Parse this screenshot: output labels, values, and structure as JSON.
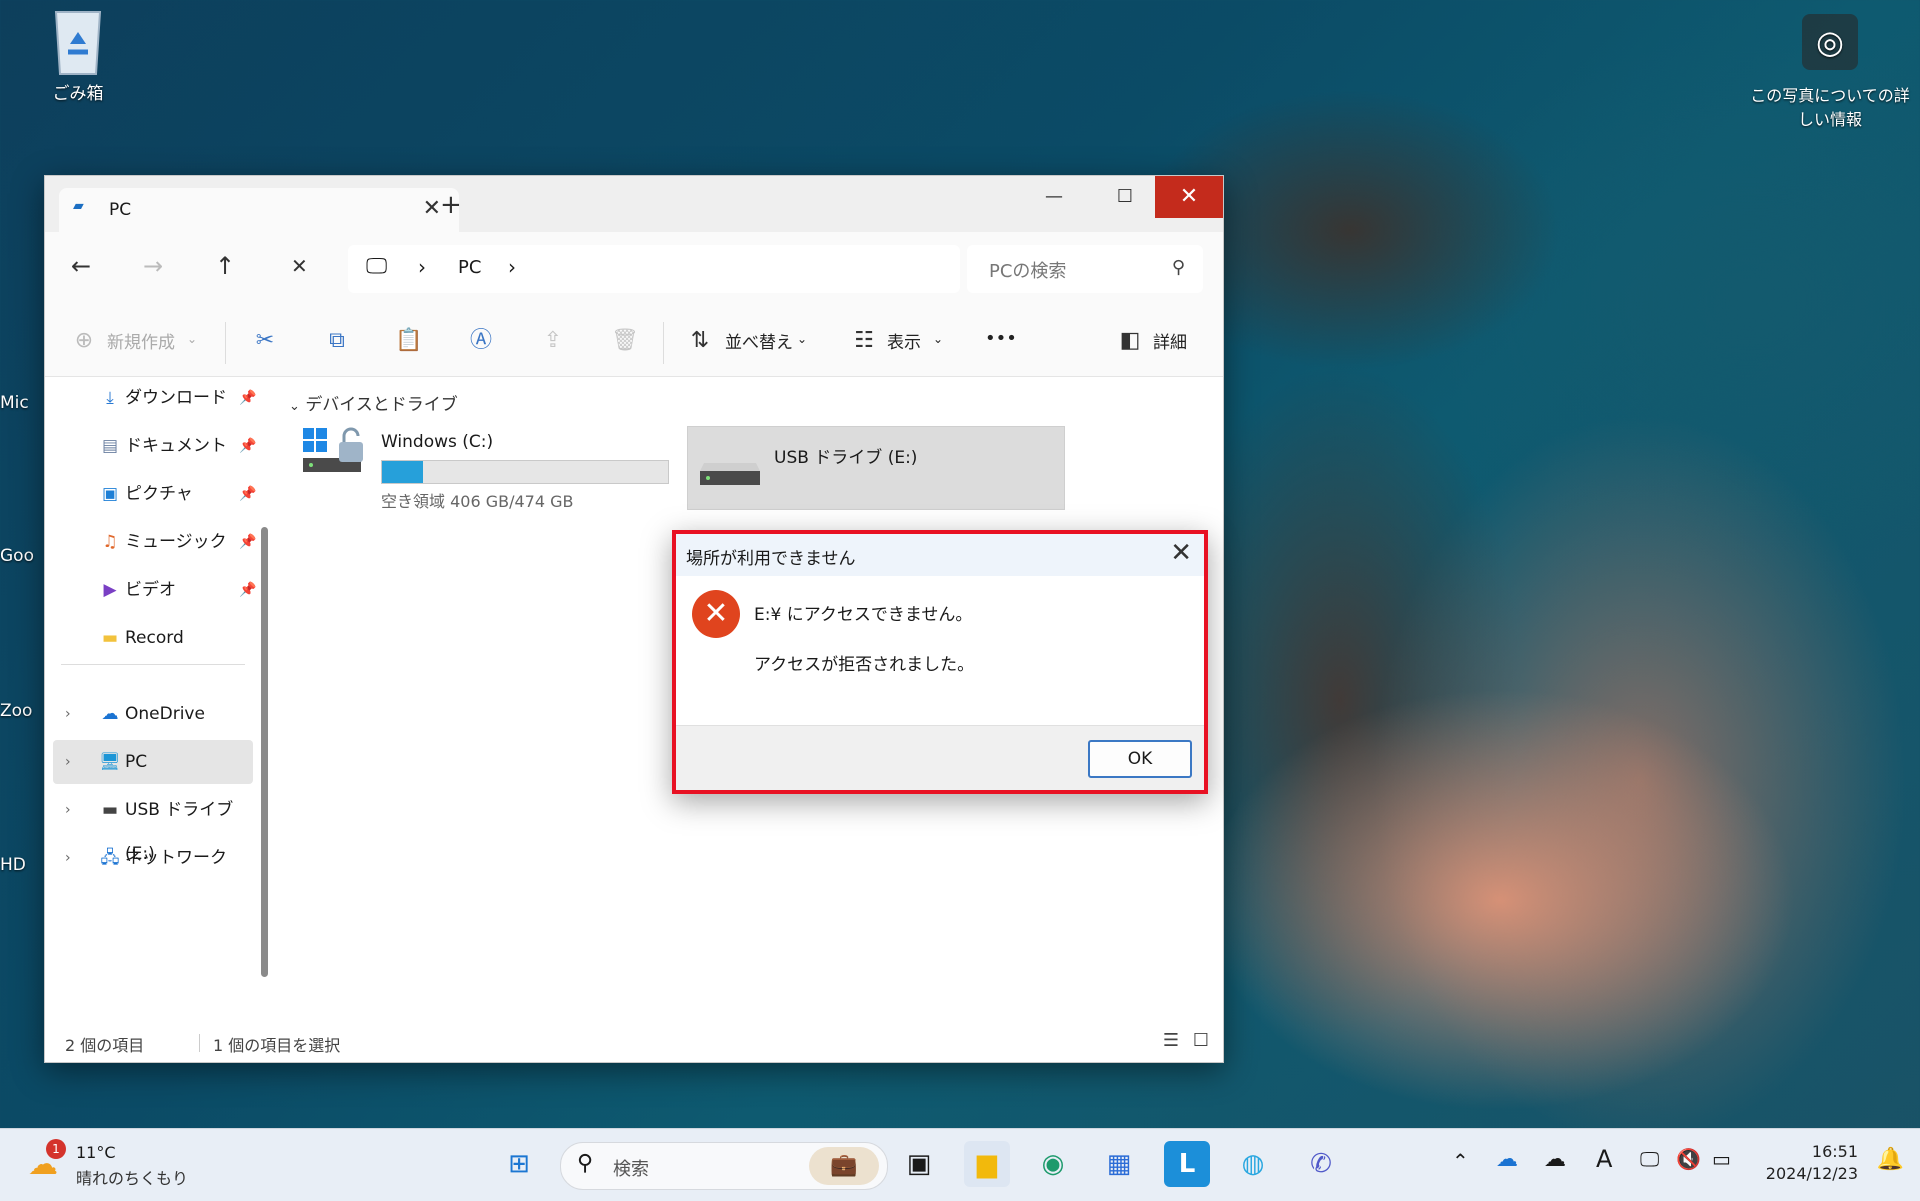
{
  "desktop": {
    "recycle_bin": "ごみ箱",
    "photo_info_line1": "この写真についての詳",
    "photo_info_line2": "しい情報",
    "side_labels": [
      "Mic",
      "Goo",
      "Zoo",
      "HD"
    ]
  },
  "window": {
    "tab_title": "PC",
    "new_tab": "+",
    "breadcrumb": {
      "item": "PC"
    },
    "search_placeholder": "PCの検索",
    "commands": {
      "new": "新規作成",
      "sort": "並べ替え",
      "view": "表示",
      "more": "•••",
      "details": "詳細"
    },
    "sidebar": {
      "quick": [
        {
          "label": "ダウンロード",
          "icon": "download-icon"
        },
        {
          "label": "ドキュメント",
          "icon": "document-icon"
        },
        {
          "label": "ピクチャ",
          "icon": "pictures-icon"
        },
        {
          "label": "ミュージック",
          "icon": "music-icon"
        },
        {
          "label": "ビデオ",
          "icon": "video-icon"
        },
        {
          "label": "Record",
          "icon": "folder-icon"
        }
      ],
      "tree": [
        {
          "label": "OneDrive",
          "icon": "cloud-icon"
        },
        {
          "label": "PC",
          "icon": "monitor-icon"
        },
        {
          "label": "USB ドライブ (E:)",
          "icon": "usb-drive-icon"
        },
        {
          "label": "ネットワーク",
          "icon": "network-icon"
        }
      ]
    },
    "content": {
      "group_header": "デバイスとドライブ",
      "drive_c": {
        "name": "Windows (C:)",
        "space": "空き領域 406 GB/474 GB",
        "used_fraction": 0.143
      },
      "drive_e": {
        "name": "USB ドライブ (E:)"
      }
    },
    "status": {
      "count": "2 個の項目",
      "selected": "1 個の項目を選択"
    }
  },
  "dialog": {
    "title": "場所が利用できません",
    "message1": "E:¥ にアクセスできません。",
    "message2": "アクセスが拒否されました。",
    "ok": "OK"
  },
  "taskbar": {
    "weather_temp": "11°C",
    "weather_desc": "晴れのちくもり",
    "weather_badge": "1",
    "search_placeholder": "検索",
    "time": "16:51",
    "date": "2024/12/23"
  }
}
